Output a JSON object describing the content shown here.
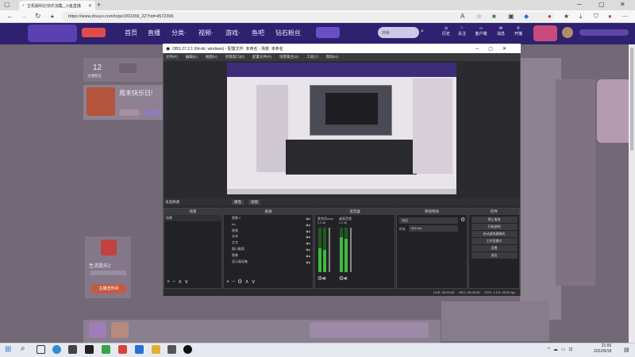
{
  "browser": {
    "tab_title": "主机版科比快乐加集_斗鱼直播",
    "url": "https://www.douyu.com/topic/2022l0t_2Z?rid=4572396"
  },
  "douyu": {
    "nav": [
      "首页",
      "直播",
      "分类·",
      "视频·",
      "游戏·",
      "鱼吧",
      "钻石粉丝"
    ],
    "search_placeholder": "搜索",
    "header_icons": [
      "历史",
      "关注",
      "客户端",
      "消息",
      "开播"
    ],
    "card_count": "12",
    "card_label": "主播粉丝",
    "week_title": "周末快乐日!",
    "live_label": "生活挺乐2",
    "live_btn": "主播宣传间"
  },
  "obs": {
    "title": "OBS 27.2.1 (64-bit, windows) - 配置文件: 未命名 - 场景: 未命名",
    "menu": [
      "文件(F)",
      "编辑(E)",
      "视图(V)",
      "停靠窗口(D)",
      "配置文件(P)",
      "场景集合(S)",
      "工具(T)",
      "帮助(H)"
    ],
    "bar_left": "未选择源",
    "bar_btn1": "属性",
    "bar_btn2": "滤镜",
    "docks": {
      "scenes": "场景",
      "sources": "来源",
      "mixer": "混音器",
      "transitions": "转场特效",
      "controls": "控件"
    },
    "scene_item": "场景",
    "sources": [
      "图像 2",
      "vlc",
      "视频",
      "文本",
      "文字",
      "窗口截获",
      "图像",
      "显示器采集"
    ],
    "mixer_ch1": "麦克风/Aux",
    "mixer_ch2": "桌面音频",
    "mixer_val1": "0.0 dB",
    "mixer_val2": "0.0 dB",
    "transition_type": "淡出",
    "duration_label": "时长",
    "duration_value": "300 ms",
    "controls": [
      "停止推流",
      "开始录制",
      "启动虚拟摄像机",
      "工作室模式",
      "设置",
      "退出"
    ],
    "status": [
      "LIVE: 00:00:00",
      "REC: 00:00:00",
      "CPU: 1.1%, 30.00 fps"
    ]
  },
  "taskbar": {
    "time": "21:00",
    "date": "2022/6/18"
  }
}
